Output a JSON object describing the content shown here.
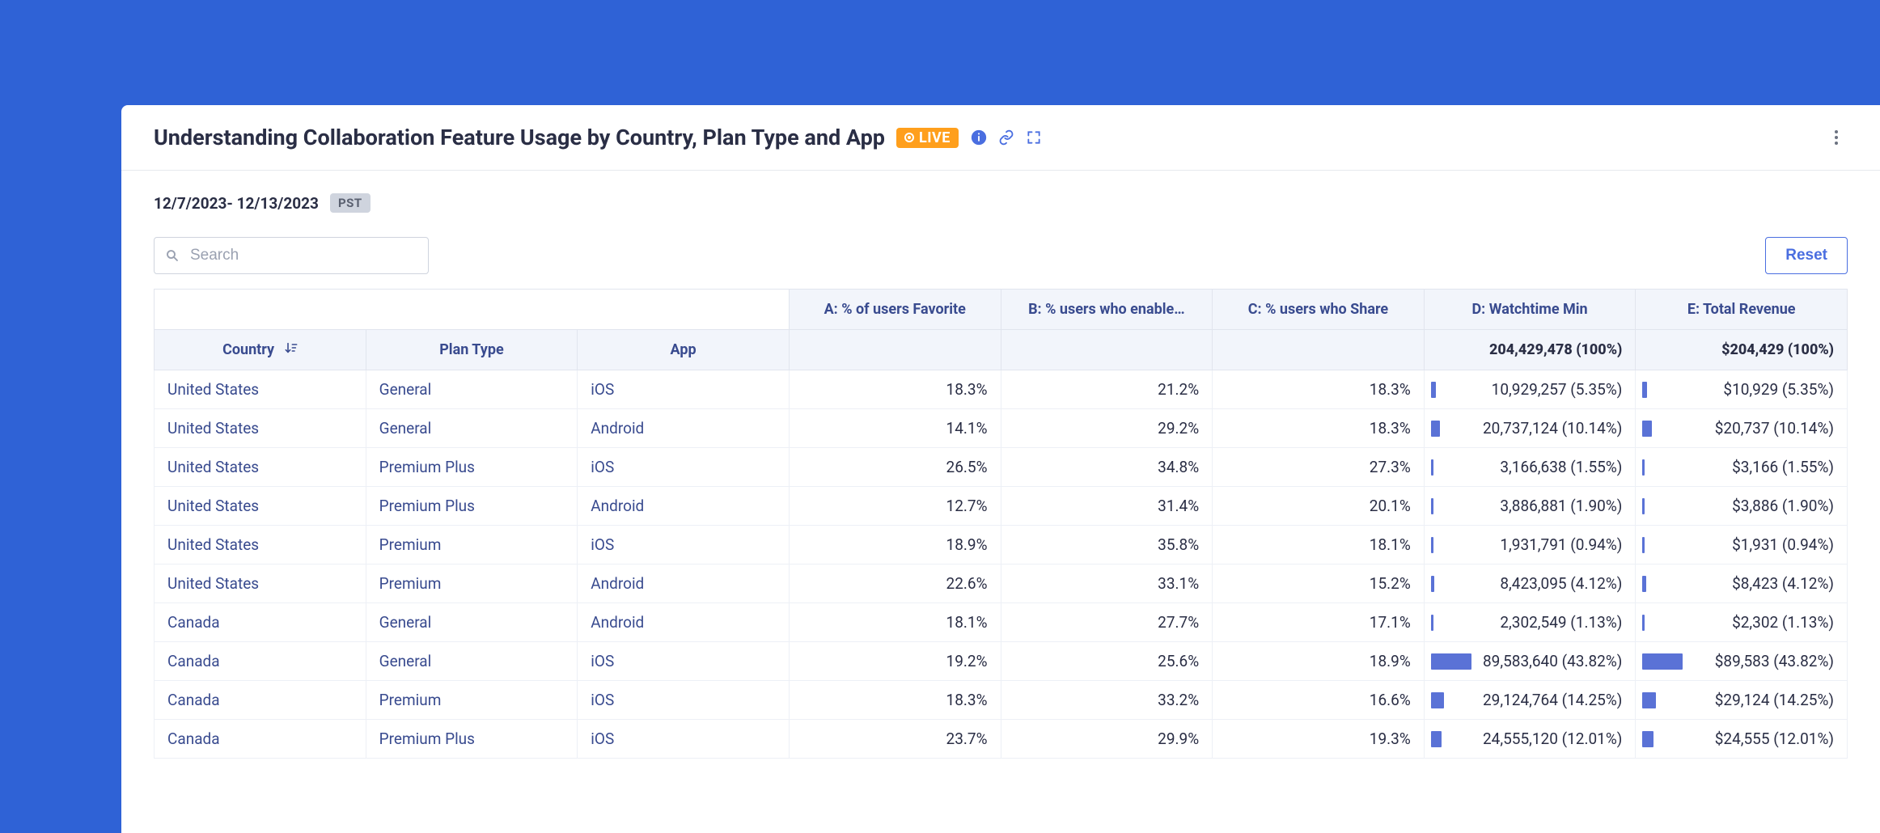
{
  "header": {
    "title": "Understanding Collaboration Feature Usage by Country, Plan Type and App",
    "live_label": "LIVE"
  },
  "subbar": {
    "date_range": "12/7/2023- 12/13/2023",
    "timezone": "PST"
  },
  "controls": {
    "search_placeholder": "Search",
    "reset_label": "Reset"
  },
  "table": {
    "dim_headers": {
      "country": "Country",
      "plan_type": "Plan Type",
      "app": "App"
    },
    "metric_headers": {
      "a": "A: % of users Favorite",
      "b": "B: % users who enable…",
      "c": "C: % users who Share",
      "d": "D: Watchtime Min",
      "e": "E: Total Revenue"
    },
    "summary": {
      "d": "204,429,478 (100%)",
      "e": "$204,429 (100%)"
    },
    "rows": [
      {
        "country": "United States",
        "plan": "General",
        "app": "iOS",
        "a": "18.3%",
        "b": "21.2%",
        "c": "18.3%",
        "d": "10,929,257 (5.35%)",
        "d_pct": 5.35,
        "e": "$10,929 (5.35%)",
        "e_pct": 5.35
      },
      {
        "country": "United States",
        "plan": "General",
        "app": "Android",
        "a": "14.1%",
        "b": "29.2%",
        "c": "18.3%",
        "d": "20,737,124 (10.14%)",
        "d_pct": 10.14,
        "e": "$20,737 (10.14%)",
        "e_pct": 10.14
      },
      {
        "country": "United States",
        "plan": "Premium Plus",
        "app": "iOS",
        "a": "26.5%",
        "b": "34.8%",
        "c": "27.3%",
        "d": "3,166,638 (1.55%)",
        "d_pct": 1.55,
        "e": "$3,166 (1.55%)",
        "e_pct": 1.55
      },
      {
        "country": "United States",
        "plan": "Premium Plus",
        "app": "Android",
        "a": "12.7%",
        "b": "31.4%",
        "c": "20.1%",
        "d": "3,886,881 (1.90%)",
        "d_pct": 1.9,
        "e": "$3,886 (1.90%)",
        "e_pct": 1.9
      },
      {
        "country": "United States",
        "plan": "Premium",
        "app": "iOS",
        "a": "18.9%",
        "b": "35.8%",
        "c": "18.1%",
        "d": "1,931,791 (0.94%)",
        "d_pct": 0.94,
        "e": "$1,931 (0.94%)",
        "e_pct": 0.94
      },
      {
        "country": "United States",
        "plan": "Premium",
        "app": "Android",
        "a": "22.6%",
        "b": "33.1%",
        "c": "15.2%",
        "d": "8,423,095 (4.12%)",
        "d_pct": 4.12,
        "e": "$8,423 (4.12%)",
        "e_pct": 4.12
      },
      {
        "country": "Canada",
        "plan": "General",
        "app": "Android",
        "a": "18.1%",
        "b": "27.7%",
        "c": "17.1%",
        "d": "2,302,549 (1.13%)",
        "d_pct": 1.13,
        "e": "$2,302 (1.13%)",
        "e_pct": 1.13
      },
      {
        "country": "Canada",
        "plan": "General",
        "app": "iOS",
        "a": "19.2%",
        "b": "25.6%",
        "c": "18.9%",
        "d": "89,583,640 (43.82%)",
        "d_pct": 43.82,
        "e": "$89,583 (43.82%)",
        "e_pct": 43.82
      },
      {
        "country": "Canada",
        "plan": "Premium",
        "app": "iOS",
        "a": "18.3%",
        "b": "33.2%",
        "c": "16.6%",
        "d": "29,124,764 (14.25%)",
        "d_pct": 14.25,
        "e": "$29,124 (14.25%)",
        "e_pct": 14.25
      },
      {
        "country": "Canada",
        "plan": "Premium Plus",
        "app": "iOS",
        "a": "23.7%",
        "b": "29.9%",
        "c": "19.3%",
        "d": "24,555,120 (12.01%)",
        "d_pct": 12.01,
        "e": "$24,555 (12.01%)",
        "e_pct": 12.01
      }
    ]
  }
}
